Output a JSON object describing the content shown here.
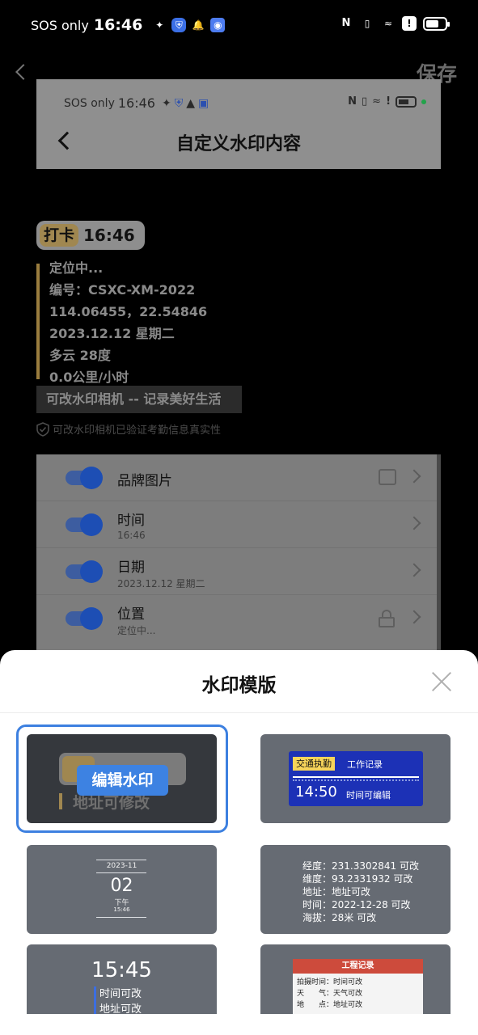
{
  "status_bar": {
    "carrier": "SOS only",
    "time": "16:46",
    "icons": [
      "wolf-icon",
      "shield-app-icon",
      "bell-icon",
      "app-icon",
      "nfc-icon",
      "vibrate-icon",
      "wifi-icon",
      "alert-icon",
      "battery-icon"
    ]
  },
  "nav": {
    "save_label": "保存"
  },
  "preview": {
    "status_carrier": "SOS only",
    "status_time": "16:46",
    "title": "自定义水印内容"
  },
  "watermark": {
    "tag_label": "打卡",
    "tag_time": "16:46",
    "lines": [
      "定位中...",
      "编号：CSXC-XM-2022",
      "114.06455，22.54846",
      "2023.12.12 星期二",
      "多云 28度",
      "0.0公里/小时"
    ],
    "slogan": "可改水印相机 -- 记录美好生活",
    "verify_text": "可改水印相机已验证考勤信息真实性"
  },
  "settings": {
    "rows": [
      {
        "label": "品牌图片",
        "sub": ""
      },
      {
        "label": "时间",
        "sub": "16:46"
      },
      {
        "label": "日期",
        "sub": "2023.12.12 星期二"
      },
      {
        "label": "位置",
        "sub": "定位中..."
      }
    ]
  },
  "sheet": {
    "title": "水印模版",
    "templates": {
      "t1": {
        "tag_label": "打卡",
        "addr": "地址可修改",
        "edit_label": "编辑水印"
      },
      "t2": {
        "badge": "交通执勤",
        "head": "工作记录",
        "time": "14:50",
        "sub": "时间可编辑"
      },
      "t3": {
        "date": "2023-11",
        "day": "02",
        "ampm": "下午",
        "time": "15:46"
      },
      "t4": {
        "lines": [
          "经度：231.3302841 可改",
          "维度：93.2331932  可改",
          "地址：地址可改",
          "时间：2022-12-28 可改",
          "海拔：28米 可改"
        ]
      },
      "t5": {
        "time": "15:45",
        "lines": [
          "时间可改",
          "地址可改"
        ]
      },
      "t6": {
        "head": "工程记录",
        "lines": [
          "拍摄时间：时间可改",
          "天　　气：天气可改",
          "地　　点：地址可改"
        ]
      }
    }
  }
}
